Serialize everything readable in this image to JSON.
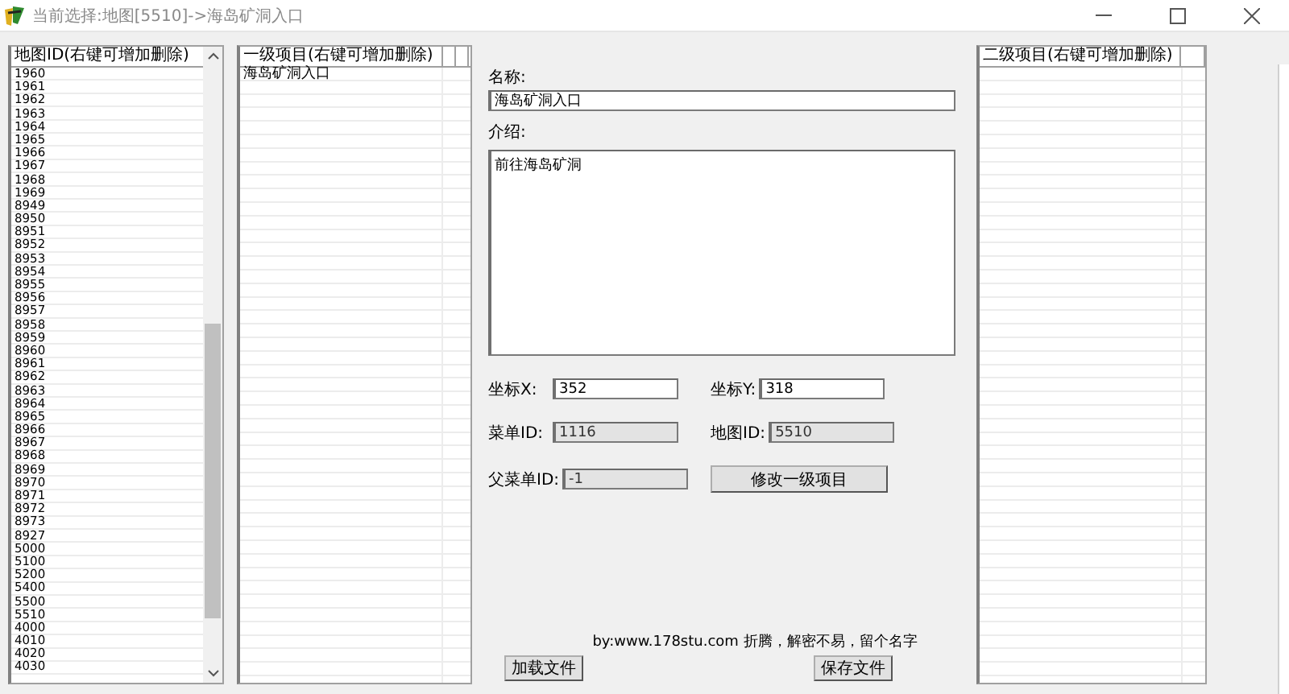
{
  "window": {
    "title": "当前选择:地图[5510]->海岛矿洞入口"
  },
  "map_list": {
    "columns": [
      "地图ID(右键可增加删除)"
    ],
    "rows": [
      "1960",
      "1961",
      "1962",
      "1963",
      "1964",
      "1965",
      "1966",
      "1967",
      "1968",
      "1969",
      "8949",
      "8950",
      "8951",
      "8952",
      "8953",
      "8954",
      "8955",
      "8956",
      "8957",
      "8958",
      "8959",
      "8960",
      "8961",
      "8962",
      "8963",
      "8964",
      "8965",
      "8966",
      "8967",
      "8968",
      "8969",
      "8970",
      "8971",
      "8972",
      "8973",
      "8927",
      "5000",
      "5100",
      "5200",
      "5400",
      "5500",
      "5510",
      "4000",
      "4010",
      "4020",
      "4030"
    ]
  },
  "first_level_list": {
    "columns": [
      "一级项目(右键可增加删除)"
    ],
    "rows": [
      "海岛矿洞入口"
    ]
  },
  "editor": {
    "name": {
      "label": "名称:",
      "value": "海岛矿洞入口"
    },
    "intro": {
      "label": "介绍:",
      "value": "前往海岛矿洞"
    },
    "fields": [
      {
        "label": "坐标X:",
        "value": "352",
        "disabled": false
      },
      {
        "label": "坐标Y:",
        "value": "318",
        "disabled": false
      },
      {
        "label": "菜单ID:",
        "value": "1116",
        "disabled": true
      },
      {
        "label": "地图ID:",
        "value": "5510",
        "disabled": true
      },
      {
        "label": "父菜单ID:",
        "value": "-1",
        "disabled": true
      }
    ],
    "modify_button": "修改一级项目",
    "credit": "by:www.178stu.com 折腾，解密不易，留个名字",
    "load_button": "加载文件",
    "save_button": "保存文件"
  },
  "second_level_list": {
    "columns": [
      "二级项目(右键可增加删除)"
    ]
  }
}
